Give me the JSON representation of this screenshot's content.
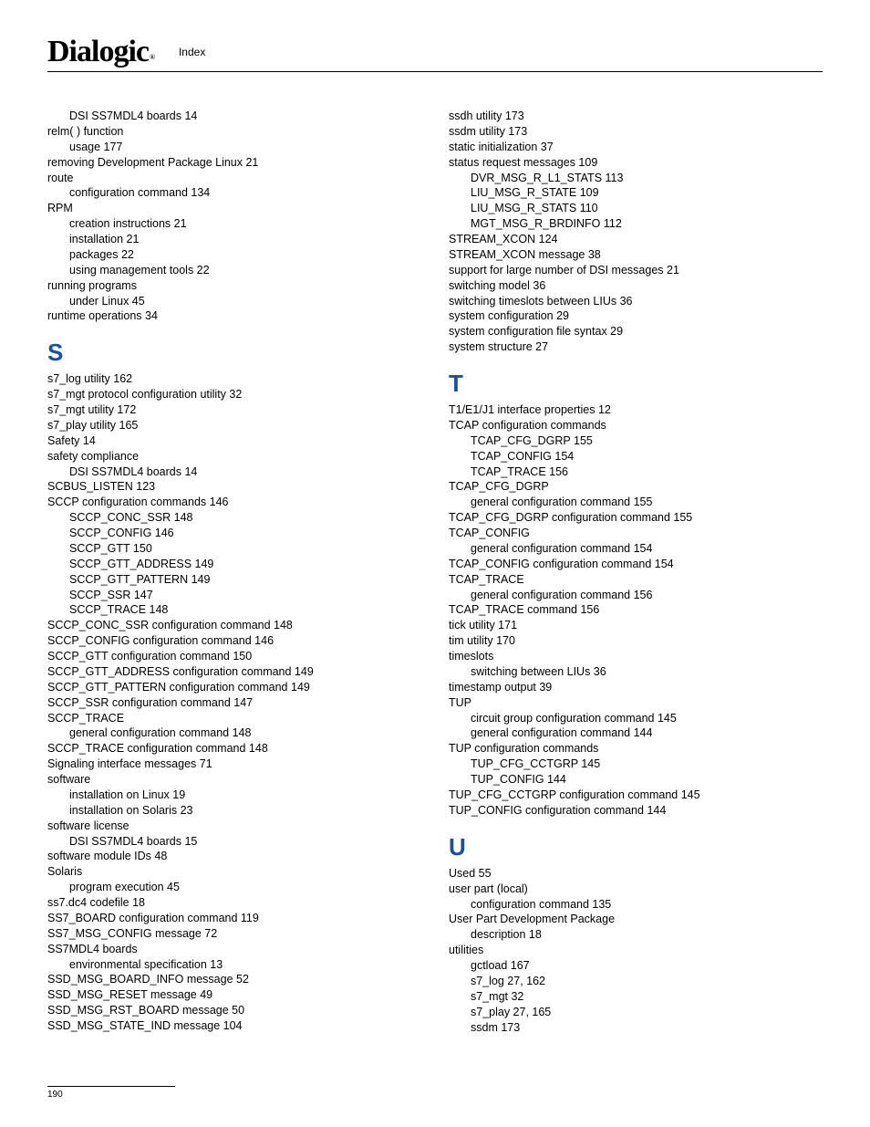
{
  "header": {
    "logo": "Dialogic",
    "reg": "®",
    "section": "Index"
  },
  "page_number": "190",
  "col1": {
    "pre": [
      {
        "t": "DSI SS7MDL4 boards 14",
        "i": 1
      },
      {
        "t": "relm( ) function",
        "i": 0
      },
      {
        "t": "usage 177",
        "i": 1
      },
      {
        "t": "removing Development Package Linux 21",
        "i": 0
      },
      {
        "t": "route",
        "i": 0
      },
      {
        "t": "configuration command 134",
        "i": 1
      },
      {
        "t": "RPM",
        "i": 0
      },
      {
        "t": "creation instructions 21",
        "i": 1
      },
      {
        "t": "installation 21",
        "i": 1
      },
      {
        "t": "packages 22",
        "i": 1
      },
      {
        "t": "using management tools 22",
        "i": 1
      },
      {
        "t": "running programs",
        "i": 0
      },
      {
        "t": "under Linux 45",
        "i": 1
      },
      {
        "t": "runtime operations 34",
        "i": 0
      }
    ],
    "S": [
      {
        "t": "s7_log utility 162",
        "i": 0
      },
      {
        "t": "s7_mgt protocol configuration utility 32",
        "i": 0
      },
      {
        "t": "s7_mgt utility 172",
        "i": 0
      },
      {
        "t": "s7_play utility 165",
        "i": 0
      },
      {
        "t": "Safety 14",
        "i": 0
      },
      {
        "t": "safety compliance",
        "i": 0
      },
      {
        "t": "DSI SS7MDL4 boards 14",
        "i": 1
      },
      {
        "t": "SCBUS_LISTEN 123",
        "i": 0
      },
      {
        "t": "SCCP configuration commands 146",
        "i": 0
      },
      {
        "t": "SCCP_CONC_SSR 148",
        "i": 1
      },
      {
        "t": "SCCP_CONFIG 146",
        "i": 1
      },
      {
        "t": "SCCP_GTT 150",
        "i": 1
      },
      {
        "t": "SCCP_GTT_ADDRESS 149",
        "i": 1
      },
      {
        "t": "SCCP_GTT_PATTERN 149",
        "i": 1
      },
      {
        "t": "SCCP_SSR 147",
        "i": 1
      },
      {
        "t": "SCCP_TRACE 148",
        "i": 1
      },
      {
        "t": "SCCP_CONC_SSR configuration command 148",
        "i": 0
      },
      {
        "t": "SCCP_CONFIG configuration command 146",
        "i": 0
      },
      {
        "t": "SCCP_GTT configuration command 150",
        "i": 0
      },
      {
        "t": "SCCP_GTT_ADDRESS configuration command 149",
        "i": 0
      },
      {
        "t": "SCCP_GTT_PATTERN configuration command 149",
        "i": 0
      },
      {
        "t": "SCCP_SSR configuration command 147",
        "i": 0
      },
      {
        "t": "SCCP_TRACE",
        "i": 0
      },
      {
        "t": "general configuration command 148",
        "i": 1
      },
      {
        "t": "SCCP_TRACE configuration command 148",
        "i": 0
      },
      {
        "t": "Signaling interface messages 71",
        "i": 0
      },
      {
        "t": "software",
        "i": 0
      },
      {
        "t": "installation on Linux 19",
        "i": 1
      },
      {
        "t": "installation on Solaris 23",
        "i": 1
      },
      {
        "t": "software license",
        "i": 0
      },
      {
        "t": "DSI SS7MDL4 boards 15",
        "i": 1
      },
      {
        "t": "software module IDs 48",
        "i": 0
      },
      {
        "t": "Solaris",
        "i": 0
      },
      {
        "t": "program execution 45",
        "i": 1
      },
      {
        "t": "ss7.dc4 codefile 18",
        "i": 0
      },
      {
        "t": "SS7_BOARD configuration command 119",
        "i": 0
      },
      {
        "t": "SS7_MSG_CONFIG message 72",
        "i": 0
      },
      {
        "t": "SS7MDL4 boards",
        "i": 0
      },
      {
        "t": "environmental specification 13",
        "i": 1
      },
      {
        "t": "SSD_MSG_BOARD_INFO message 52",
        "i": 0
      },
      {
        "t": "SSD_MSG_RESET message 49",
        "i": 0
      },
      {
        "t": "SSD_MSG_RST_BOARD message 50",
        "i": 0
      },
      {
        "t": "SSD_MSG_STATE_IND message 104",
        "i": 0
      }
    ]
  },
  "col2": {
    "pre": [
      {
        "t": "ssdh utility 173",
        "i": 0
      },
      {
        "t": "ssdm utility 173",
        "i": 0
      },
      {
        "t": "static initialization 37",
        "i": 0
      },
      {
        "t": "status request messages 109",
        "i": 0
      },
      {
        "t": "DVR_MSG_R_L1_STATS 113",
        "i": 1
      },
      {
        "t": "LIU_MSG_R_STATE 109",
        "i": 1
      },
      {
        "t": "LIU_MSG_R_STATS 110",
        "i": 1
      },
      {
        "t": "MGT_MSG_R_BRDINFO 112",
        "i": 1
      },
      {
        "t": "STREAM_XCON 124",
        "i": 0
      },
      {
        "t": "STREAM_XCON message 38",
        "i": 0
      },
      {
        "t": "support for large number of DSI messages 21",
        "i": 0
      },
      {
        "t": "switching model 36",
        "i": 0
      },
      {
        "t": "switching timeslots between LIUs 36",
        "i": 0
      },
      {
        "t": "system configuration 29",
        "i": 0
      },
      {
        "t": "system configuration file syntax 29",
        "i": 0
      },
      {
        "t": "system structure 27",
        "i": 0
      }
    ],
    "T": [
      {
        "t": "T1/E1/J1 interface properties 12",
        "i": 0
      },
      {
        "t": "TCAP configuration commands",
        "i": 0
      },
      {
        "t": "TCAP_CFG_DGRP 155",
        "i": 1
      },
      {
        "t": "TCAP_CONFIG 154",
        "i": 1
      },
      {
        "t": "TCAP_TRACE 156",
        "i": 1
      },
      {
        "t": "TCAP_CFG_DGRP",
        "i": 0
      },
      {
        "t": "general configuration command 155",
        "i": 1
      },
      {
        "t": "TCAP_CFG_DGRP configuration command 155",
        "i": 0
      },
      {
        "t": "TCAP_CONFIG",
        "i": 0
      },
      {
        "t": "general configuration command 154",
        "i": 1
      },
      {
        "t": "TCAP_CONFIG configuration command 154",
        "i": 0
      },
      {
        "t": "TCAP_TRACE",
        "i": 0
      },
      {
        "t": "general configuration command 156",
        "i": 1
      },
      {
        "t": "TCAP_TRACE command 156",
        "i": 0
      },
      {
        "t": "tick utility 171",
        "i": 0
      },
      {
        "t": "tim utility 170",
        "i": 0
      },
      {
        "t": "timeslots",
        "i": 0
      },
      {
        "t": "switching between LIUs 36",
        "i": 1
      },
      {
        "t": "timestamp output 39",
        "i": 0
      },
      {
        "t": "TUP",
        "i": 0
      },
      {
        "t": "circuit group configuration command 145",
        "i": 1
      },
      {
        "t": "general configuration command 144",
        "i": 1
      },
      {
        "t": "TUP configuration commands",
        "i": 0
      },
      {
        "t": "TUP_CFG_CCTGRP 145",
        "i": 1
      },
      {
        "t": "TUP_CONFIG 144",
        "i": 1
      },
      {
        "t": "TUP_CFG_CCTGRP configuration command 145",
        "i": 0
      },
      {
        "t": "TUP_CONFIG configuration command 144",
        "i": 0
      }
    ],
    "U": [
      {
        "t": "Used 55",
        "i": 0
      },
      {
        "t": "user part (local)",
        "i": 0
      },
      {
        "t": "configuration command 135",
        "i": 1
      },
      {
        "t": "User Part Development Package",
        "i": 0
      },
      {
        "t": "description 18",
        "i": 1
      },
      {
        "t": "utilities",
        "i": 0
      },
      {
        "t": "gctload 167",
        "i": 1
      },
      {
        "t": "s7_log 27, 162",
        "i": 1
      },
      {
        "t": "s7_mgt 32",
        "i": 1
      },
      {
        "t": "s7_play 27, 165",
        "i": 1
      },
      {
        "t": "ssdm 173",
        "i": 1
      }
    ]
  },
  "letters": {
    "S": "S",
    "T": "T",
    "U": "U"
  }
}
